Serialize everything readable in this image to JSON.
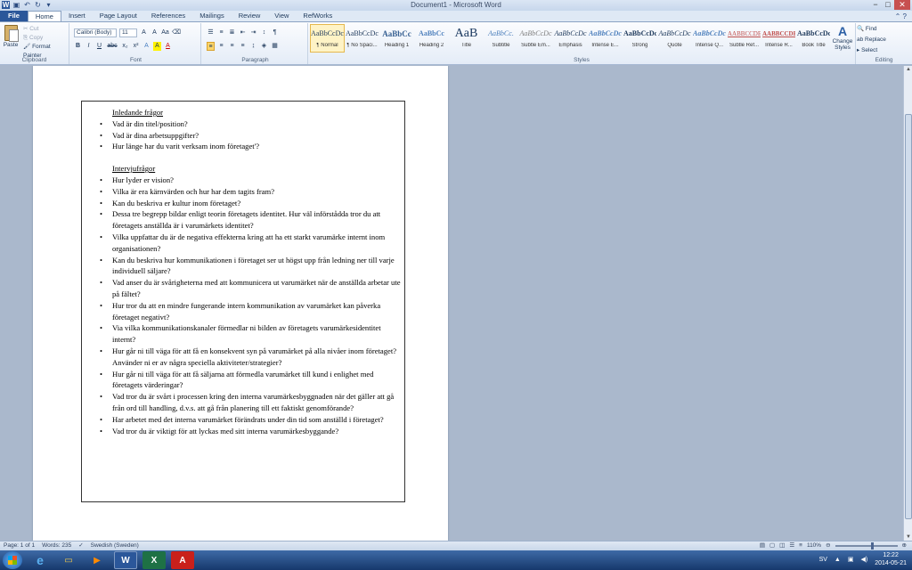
{
  "window": {
    "title": "Document1 - Microsoft Word",
    "min": "−",
    "max": "□",
    "close": "✕"
  },
  "tabs": [
    "File",
    "Home",
    "Insert",
    "Page Layout",
    "References",
    "Mailings",
    "Review",
    "View",
    "RefWorks"
  ],
  "ribbon": {
    "clipboard": {
      "paste": "Paste",
      "cut": "Cut",
      "copy": "Copy",
      "format_painter": "Format Painter",
      "label": "Clipboard"
    },
    "font": {
      "name": "Calibri (Body)",
      "size": "11",
      "label": "Font",
      "buttons": [
        "B",
        "I",
        "U",
        "abc",
        "x₂",
        "x²",
        "A",
        "A",
        "A"
      ]
    },
    "paragraph": {
      "label": "Paragraph",
      "pilcrow": "¶"
    },
    "styles": {
      "label": "Styles",
      "items": [
        {
          "preview": "AaBbCcDc",
          "name": "¶ Normal"
        },
        {
          "preview": "AaBbCcDc",
          "name": "¶ No Spaci..."
        },
        {
          "preview": "AaBbCc",
          "name": "Heading 1"
        },
        {
          "preview": "AaBbCc",
          "name": "Heading 2"
        },
        {
          "preview": "AaB",
          "name": "Title"
        },
        {
          "preview": "AaBbCc.",
          "name": "Subtitle"
        },
        {
          "preview": "AaBbCcDc",
          "name": "Subtle Em..."
        },
        {
          "preview": "AaBbCcDc",
          "name": "Emphasis"
        },
        {
          "preview": "AaBbCcDc",
          "name": "Intense E..."
        },
        {
          "preview": "AaBbCcDc",
          "name": "Strong"
        },
        {
          "preview": "AaBbCcDc",
          "name": "Quote"
        },
        {
          "preview": "AaBbCcDc",
          "name": "Intense Q..."
        },
        {
          "preview": "AABBCCDE",
          "name": "Subtle Ref..."
        },
        {
          "preview": "AABBCCDE",
          "name": "Intense R..."
        },
        {
          "preview": "AaBbCcDc",
          "name": "Book Title"
        }
      ],
      "change_styles": "Change Styles"
    },
    "editing": {
      "label": "Editing",
      "find": "Find",
      "replace": "Replace",
      "select": "Select"
    }
  },
  "document": {
    "heading1": "Inledande frågor",
    "list1": [
      "Vad är din titel/position?",
      "Vad är dina arbetsuppgifter?",
      "Hur länge har du varit verksam inom företaget'?"
    ],
    "heading2": "Intervjufrågor",
    "list2": [
      "Hur lyder er vision?",
      "Vilka är era kärnvärden och hur har dem tagits fram?",
      "Kan du beskriva er kultur inom företaget?",
      "Dessa tre begrepp bildar enligt teorin företagets identitet. Hur väl införstådda tror du att företagets anställda är i varumärkets identitet?",
      "Vilka uppfattar du är de negativa effekterna kring att ha ett starkt varumärke internt inom organisationen?",
      "Kan du beskriva hur kommunikationen i företaget ser ut högst upp från ledning ner till varje individuell säljare?",
      "Vad anser du är svårigheterna med att kommunicera ut varumärket när de anställda arbetar ute på fältet?",
      "Hur tror du att en mindre fungerande intern kommunikation av varumärket kan påverka företaget negativt?",
      "Via vilka kommunikationskanaler förmedlar ni bilden av företagets varumärkesidentitet internt?",
      "Hur går ni till väga för att få en konsekvent syn på varumärket på alla nivåer inom företaget? Använder ni er av några speciella aktiviteter/strategier?",
      "Hur går ni till väga för att få säljarna att förmedla varumärket till kund i enlighet med företagets värderingar?",
      "Vad tror du är svårt i processen kring den interna varumärkesbyggnaden när det gäller att gå från ord till handling, d.v.s. att gå från planering till ett faktiskt genomförande?",
      "Har arbetet med det interna varumärket förändrats under din tid som anställd i företaget?",
      "Vad tror du är viktigt för att lyckas med sitt interna varumärkesbyggande?"
    ]
  },
  "status": {
    "page": "Page: 1 of 1",
    "words": "Words: 235",
    "language": "Swedish (Sweden)",
    "zoom": "110%"
  },
  "taskbar": {
    "lang": "SV",
    "time": "12:22",
    "date": "2014-05-21"
  }
}
